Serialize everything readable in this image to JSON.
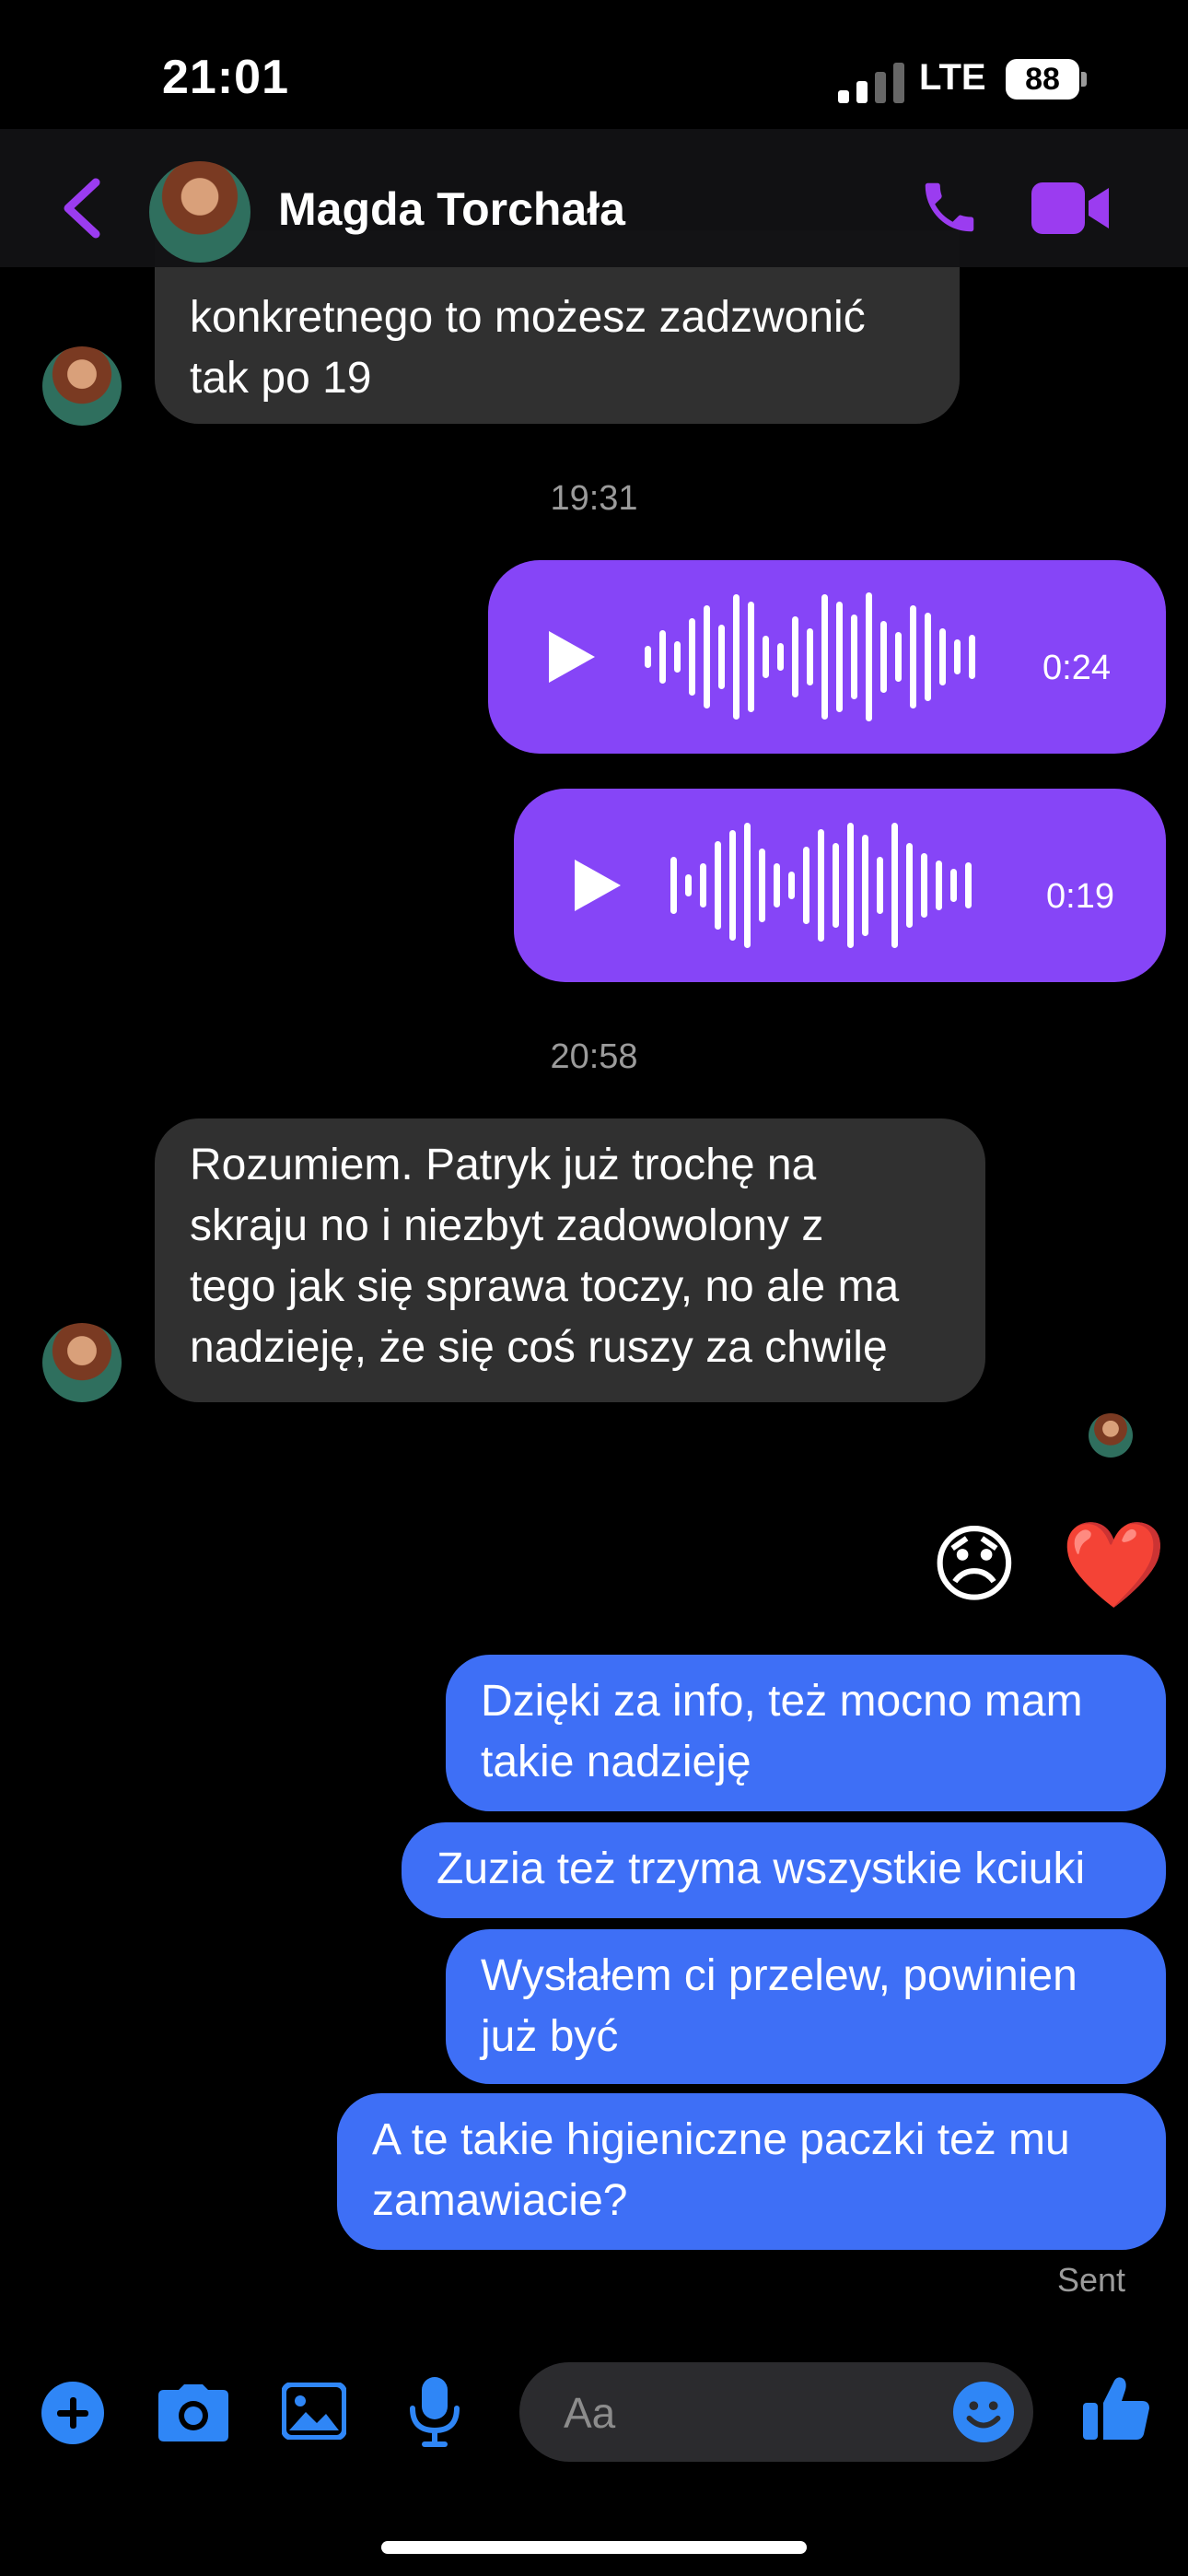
{
  "status": {
    "time": "21:01",
    "network": "LTE",
    "battery": "88"
  },
  "header": {
    "contact_name": "Magda Torchała"
  },
  "messages": {
    "m1": {
      "lines": [
        "konkretnego to możesz zadzwonić",
        "tak po 19"
      ]
    },
    "ts1": "19:31",
    "voice1": {
      "duration": "0:24"
    },
    "voice2": {
      "duration": "0:19"
    },
    "ts2": "20:58",
    "m2": {
      "lines": [
        "Rozumiem. Patryk już trochę na",
        "skraju no i niezbyt zadowolony z",
        "tego jak się sprawa toczy, no ale ma",
        "nadzieję, że się coś ruszy za chwilę"
      ]
    },
    "reactions": [
      "😞",
      "❤️"
    ],
    "o1": {
      "lines": [
        "Dzięki za info, też mocno mam",
        "takie nadzieję"
      ]
    },
    "o2": {
      "lines": [
        "Zuzia też trzyma wszystkie kciuki"
      ]
    },
    "o3": {
      "lines": [
        "Wysłałem ci przelew, powinien",
        "już być"
      ]
    },
    "o4": {
      "lines": [
        "A te takie higieniczne paczki też mu",
        "zamawiacie?"
      ]
    },
    "sent_status": "Sent"
  },
  "composer": {
    "placeholder": "Aa"
  },
  "colors": {
    "accent": "#9b3cf0",
    "outgoing": "#3e6ff6",
    "voice": "#8645f7",
    "incoming": "#303030",
    "toolbar_icon": "#2f86f6"
  }
}
